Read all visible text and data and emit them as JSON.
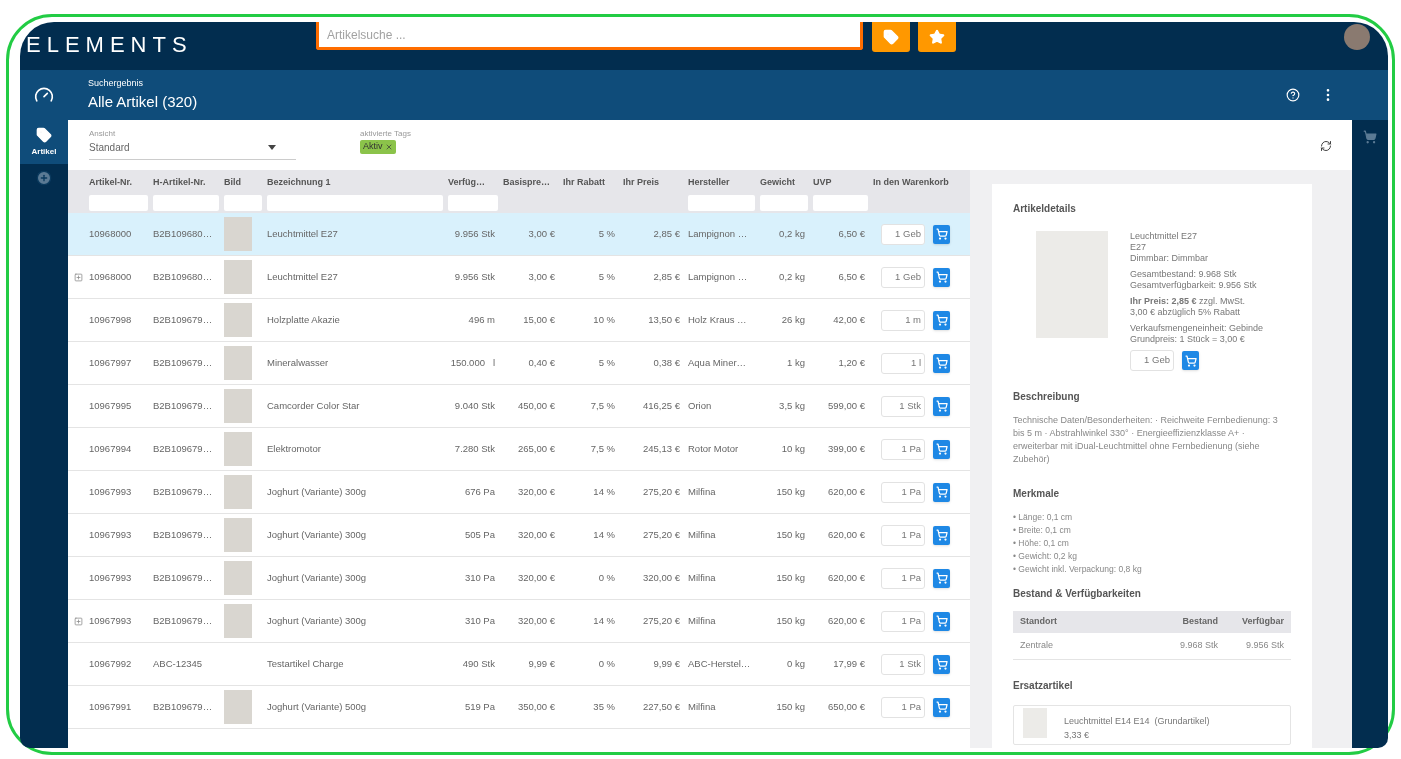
{
  "app": {
    "logo": "ELEMENTS"
  },
  "search": {
    "placeholder": "Artikelsuche ..."
  },
  "header": {
    "subtitle": "Suchergebnis",
    "title": "Alle Artikel (320)"
  },
  "sidebar": {
    "items": [
      {
        "kind": "dashboard",
        "selected": false
      },
      {
        "kind": "tag",
        "label": "Artikel",
        "selected": true
      },
      {
        "kind": "add",
        "selected": false
      }
    ]
  },
  "view": {
    "label": "Ansicht",
    "value": "Standard"
  },
  "tags": {
    "label": "aktivierte Tags",
    "items": [
      {
        "label": "Aktiv",
        "color": "#8bc34a"
      }
    ]
  },
  "table": {
    "columns": [
      {
        "label": "Artikel-Nr.",
        "filter": true
      },
      {
        "label": "H-Artikel-Nr.",
        "filter": true
      },
      {
        "label": "Bild",
        "filter": true
      },
      {
        "label": "Bezeichnung 1",
        "filter": true
      },
      {
        "label": "Verfüg…",
        "filter": true
      },
      {
        "label": "Basispre…",
        "filter": false
      },
      {
        "label": "Ihr Rabatt",
        "filter": false
      },
      {
        "label": "Ihr Preis",
        "filter": false
      },
      {
        "label": "Hersteller",
        "filter": true
      },
      {
        "label": "Gewicht",
        "filter": true
      },
      {
        "label": "UVP",
        "filter": true
      },
      {
        "label": "In den Warenkorb",
        "filter": false
      }
    ],
    "rows": [
      {
        "selected": true,
        "expandable": false,
        "photo": true,
        "nr": "10968000",
        "h_nr": "B2B109680…",
        "name": "Leuchtmittel E27",
        "stock": "9.956 Stk",
        "base": "3,00 €",
        "discount": "5 %",
        "price": "2,85 €",
        "maker": "Lampignon …",
        "weight": "0,2 kg",
        "uvp": "6,50 €",
        "qty": "1 Geb"
      },
      {
        "selected": false,
        "expandable": true,
        "photo": true,
        "nr": "10968000",
        "h_nr": "B2B109680…",
        "name": "Leuchtmittel E27",
        "stock": "9.956 Stk",
        "base": "3,00 €",
        "discount": "5 %",
        "price": "2,85 €",
        "maker": "Lampignon …",
        "weight": "0,2 kg",
        "uvp": "6,50 €",
        "qty": "1 Geb"
      },
      {
        "selected": false,
        "expandable": false,
        "photo": true,
        "nr": "10967998",
        "h_nr": "B2B109679…",
        "name": "Holzplatte Akazie",
        "stock": "496 m",
        "base": "15,00 €",
        "discount": "10 %",
        "price": "13,50 €",
        "maker": "Holz Kraus …",
        "weight": "26 kg",
        "uvp": "42,00 €",
        "qty": "1 m"
      },
      {
        "selected": false,
        "expandable": false,
        "photo": true,
        "nr": "10967997",
        "h_nr": "B2B109679…",
        "name": "Mineralwasser",
        "stock": "150.000   l",
        "base": "0,40 €",
        "discount": "5 %",
        "price": "0,38 €",
        "maker": "Aqua Miner…",
        "weight": "1 kg",
        "uvp": "1,20 €",
        "qty": "1 l"
      },
      {
        "selected": false,
        "expandable": false,
        "photo": true,
        "nr": "10967995",
        "h_nr": "B2B109679…",
        "name": "Camcorder Color Star",
        "stock": "9.040 Stk",
        "base": "450,00 €",
        "discount": "7,5 %",
        "price": "416,25 €",
        "maker": "Orion",
        "weight": "3,5 kg",
        "uvp": "599,00 €",
        "qty": "1 Stk"
      },
      {
        "selected": false,
        "expandable": false,
        "photo": true,
        "nr": "10967994",
        "h_nr": "B2B109679…",
        "name": "Elektromotor",
        "stock": "7.280 Stk",
        "base": "265,00 €",
        "discount": "7,5 %",
        "price": "245,13 €",
        "maker": "Rotor Motor",
        "weight": "10 kg",
        "uvp": "399,00 €",
        "qty": "1 Pa"
      },
      {
        "selected": false,
        "expandable": false,
        "photo": true,
        "nr": "10967993",
        "h_nr": "B2B109679…",
        "name": "Joghurt (Variante) 300g",
        "stock": "676 Pa",
        "base": "320,00 €",
        "discount": "14 %",
        "price": "275,20 €",
        "maker": "Milfina",
        "weight": "150 kg",
        "uvp": "620,00 €",
        "qty": "1 Pa"
      },
      {
        "selected": false,
        "expandable": false,
        "photo": true,
        "nr": "10967993",
        "h_nr": "B2B109679…",
        "name": "Joghurt (Variante) 300g",
        "stock": "505 Pa",
        "base": "320,00 €",
        "discount": "14 %",
        "price": "275,20 €",
        "maker": "Milfina",
        "weight": "150 kg",
        "uvp": "620,00 €",
        "qty": "1 Pa"
      },
      {
        "selected": false,
        "expandable": false,
        "photo": true,
        "nr": "10967993",
        "h_nr": "B2B109679…",
        "name": "Joghurt (Variante) 300g",
        "stock": "310 Pa",
        "base": "320,00 €",
        "discount": "0 %",
        "price": "320,00 €",
        "maker": "Milfina",
        "weight": "150 kg",
        "uvp": "620,00 €",
        "qty": "1 Pa"
      },
      {
        "selected": false,
        "expandable": true,
        "photo": true,
        "nr": "10967993",
        "h_nr": "B2B109679…",
        "name": "Joghurt (Variante) 300g",
        "stock": "310 Pa",
        "base": "320,00 €",
        "discount": "14 %",
        "price": "275,20 €",
        "maker": "Milfina",
        "weight": "150 kg",
        "uvp": "620,00 €",
        "qty": "1 Pa"
      },
      {
        "selected": false,
        "expandable": false,
        "photo": false,
        "nr": "10967992",
        "h_nr": "ABC-12345",
        "name": "Testartikel Charge",
        "stock": "490 Stk",
        "base": "9,99 €",
        "discount": "0 %",
        "price": "9,99 €",
        "maker": "ABC-Herstel…",
        "weight": "0 kg",
        "uvp": "17,99 €",
        "qty": "1 Stk"
      },
      {
        "selected": false,
        "expandable": false,
        "photo": true,
        "nr": "10967991",
        "h_nr": "B2B109679…",
        "name": "Joghurt (Variante) 500g",
        "stock": "519 Pa",
        "base": "350,00 €",
        "discount": "35 %",
        "price": "227,50 €",
        "maker": "Milfina",
        "weight": "150 kg",
        "uvp": "650,00 €",
        "qty": "1 Pa"
      }
    ]
  },
  "details": {
    "title": "Artikeldetails",
    "info_groups": [
      [
        "Leuchtmittel E27",
        "E27",
        "Dimmbar: Dimmbar"
      ],
      [
        "Gesamtbestand: 9.968 Stk",
        "Gesamtverfügbarkeit: 9.956 Stk"
      ],
      [
        "**Ihr Preis: 2,85 €** zzgl. MwSt.",
        "3,00 € abzüglich 5% Rabatt"
      ],
      [
        "Verkaufsmengeneinheit: Gebinde",
        "Grundpreis: 1 Stück = 3,00 €"
      ]
    ],
    "qty": "1 Geb",
    "description": {
      "title": "Beschreibung",
      "text": "Technische Daten/Besonderheiten: · Reichweite Fernbedienung: 3 bis 5 m · Abstrahlwinkel 330° · Energieeffizienzklasse A+ · erweiterbar mit iDual-Leuchtmittel ohne Fernbedienung (siehe Zubehör)"
    },
    "features": {
      "title": "Merkmale",
      "items": [
        "• Länge: 0,1 cm",
        "• Breite: 0,1 cm",
        "• Höhe: 0,1 cm",
        "• Gewicht: 0,2 kg",
        "• Gewicht inkl. Verpackung: 0,8 kg"
      ]
    },
    "stock": {
      "title": "Bestand & Verfügbarkeiten",
      "columns": [
        "Standort",
        "Bestand",
        "Verfügbar"
      ],
      "rows": [
        [
          "Zentrale",
          "9.968 Stk",
          "9.956 Stk"
        ]
      ]
    },
    "replacements": {
      "title": "Ersatzartikel",
      "items": [
        {
          "name": "Leuchtmittel E14 E14  (Grundartikel)",
          "price": "3,33 €"
        }
      ]
    }
  }
}
